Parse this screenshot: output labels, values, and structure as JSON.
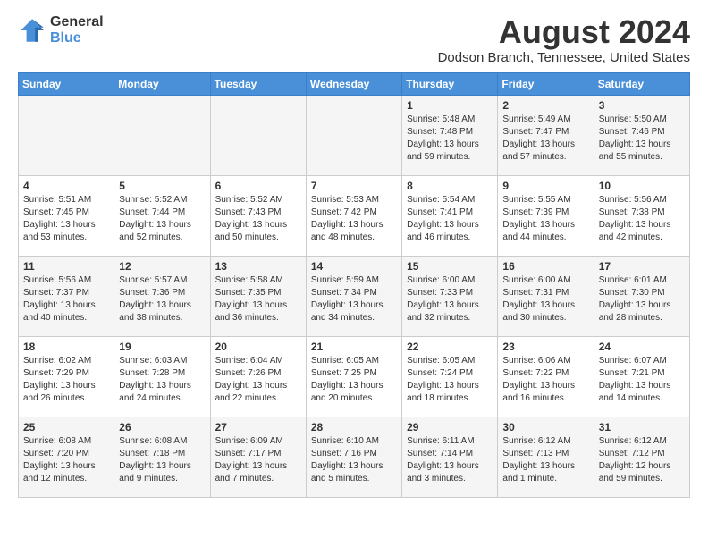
{
  "header": {
    "logo_general": "General",
    "logo_blue": "Blue",
    "main_title": "August 2024",
    "subtitle": "Dodson Branch, Tennessee, United States"
  },
  "weekdays": [
    "Sunday",
    "Monday",
    "Tuesday",
    "Wednesday",
    "Thursday",
    "Friday",
    "Saturday"
  ],
  "weeks": [
    [
      {
        "day": "",
        "text": ""
      },
      {
        "day": "",
        "text": ""
      },
      {
        "day": "",
        "text": ""
      },
      {
        "day": "",
        "text": ""
      },
      {
        "day": "1",
        "text": "Sunrise: 5:48 AM\nSunset: 7:48 PM\nDaylight: 13 hours\nand 59 minutes."
      },
      {
        "day": "2",
        "text": "Sunrise: 5:49 AM\nSunset: 7:47 PM\nDaylight: 13 hours\nand 57 minutes."
      },
      {
        "day": "3",
        "text": "Sunrise: 5:50 AM\nSunset: 7:46 PM\nDaylight: 13 hours\nand 55 minutes."
      }
    ],
    [
      {
        "day": "4",
        "text": "Sunrise: 5:51 AM\nSunset: 7:45 PM\nDaylight: 13 hours\nand 53 minutes."
      },
      {
        "day": "5",
        "text": "Sunrise: 5:52 AM\nSunset: 7:44 PM\nDaylight: 13 hours\nand 52 minutes."
      },
      {
        "day": "6",
        "text": "Sunrise: 5:52 AM\nSunset: 7:43 PM\nDaylight: 13 hours\nand 50 minutes."
      },
      {
        "day": "7",
        "text": "Sunrise: 5:53 AM\nSunset: 7:42 PM\nDaylight: 13 hours\nand 48 minutes."
      },
      {
        "day": "8",
        "text": "Sunrise: 5:54 AM\nSunset: 7:41 PM\nDaylight: 13 hours\nand 46 minutes."
      },
      {
        "day": "9",
        "text": "Sunrise: 5:55 AM\nSunset: 7:39 PM\nDaylight: 13 hours\nand 44 minutes."
      },
      {
        "day": "10",
        "text": "Sunrise: 5:56 AM\nSunset: 7:38 PM\nDaylight: 13 hours\nand 42 minutes."
      }
    ],
    [
      {
        "day": "11",
        "text": "Sunrise: 5:56 AM\nSunset: 7:37 PM\nDaylight: 13 hours\nand 40 minutes."
      },
      {
        "day": "12",
        "text": "Sunrise: 5:57 AM\nSunset: 7:36 PM\nDaylight: 13 hours\nand 38 minutes."
      },
      {
        "day": "13",
        "text": "Sunrise: 5:58 AM\nSunset: 7:35 PM\nDaylight: 13 hours\nand 36 minutes."
      },
      {
        "day": "14",
        "text": "Sunrise: 5:59 AM\nSunset: 7:34 PM\nDaylight: 13 hours\nand 34 minutes."
      },
      {
        "day": "15",
        "text": "Sunrise: 6:00 AM\nSunset: 7:33 PM\nDaylight: 13 hours\nand 32 minutes."
      },
      {
        "day": "16",
        "text": "Sunrise: 6:00 AM\nSunset: 7:31 PM\nDaylight: 13 hours\nand 30 minutes."
      },
      {
        "day": "17",
        "text": "Sunrise: 6:01 AM\nSunset: 7:30 PM\nDaylight: 13 hours\nand 28 minutes."
      }
    ],
    [
      {
        "day": "18",
        "text": "Sunrise: 6:02 AM\nSunset: 7:29 PM\nDaylight: 13 hours\nand 26 minutes."
      },
      {
        "day": "19",
        "text": "Sunrise: 6:03 AM\nSunset: 7:28 PM\nDaylight: 13 hours\nand 24 minutes."
      },
      {
        "day": "20",
        "text": "Sunrise: 6:04 AM\nSunset: 7:26 PM\nDaylight: 13 hours\nand 22 minutes."
      },
      {
        "day": "21",
        "text": "Sunrise: 6:05 AM\nSunset: 7:25 PM\nDaylight: 13 hours\nand 20 minutes."
      },
      {
        "day": "22",
        "text": "Sunrise: 6:05 AM\nSunset: 7:24 PM\nDaylight: 13 hours\nand 18 minutes."
      },
      {
        "day": "23",
        "text": "Sunrise: 6:06 AM\nSunset: 7:22 PM\nDaylight: 13 hours\nand 16 minutes."
      },
      {
        "day": "24",
        "text": "Sunrise: 6:07 AM\nSunset: 7:21 PM\nDaylight: 13 hours\nand 14 minutes."
      }
    ],
    [
      {
        "day": "25",
        "text": "Sunrise: 6:08 AM\nSunset: 7:20 PM\nDaylight: 13 hours\nand 12 minutes."
      },
      {
        "day": "26",
        "text": "Sunrise: 6:08 AM\nSunset: 7:18 PM\nDaylight: 13 hours\nand 9 minutes."
      },
      {
        "day": "27",
        "text": "Sunrise: 6:09 AM\nSunset: 7:17 PM\nDaylight: 13 hours\nand 7 minutes."
      },
      {
        "day": "28",
        "text": "Sunrise: 6:10 AM\nSunset: 7:16 PM\nDaylight: 13 hours\nand 5 minutes."
      },
      {
        "day": "29",
        "text": "Sunrise: 6:11 AM\nSunset: 7:14 PM\nDaylight: 13 hours\nand 3 minutes."
      },
      {
        "day": "30",
        "text": "Sunrise: 6:12 AM\nSunset: 7:13 PM\nDaylight: 13 hours\nand 1 minute."
      },
      {
        "day": "31",
        "text": "Sunrise: 6:12 AM\nSunset: 7:12 PM\nDaylight: 12 hours\nand 59 minutes."
      }
    ]
  ]
}
